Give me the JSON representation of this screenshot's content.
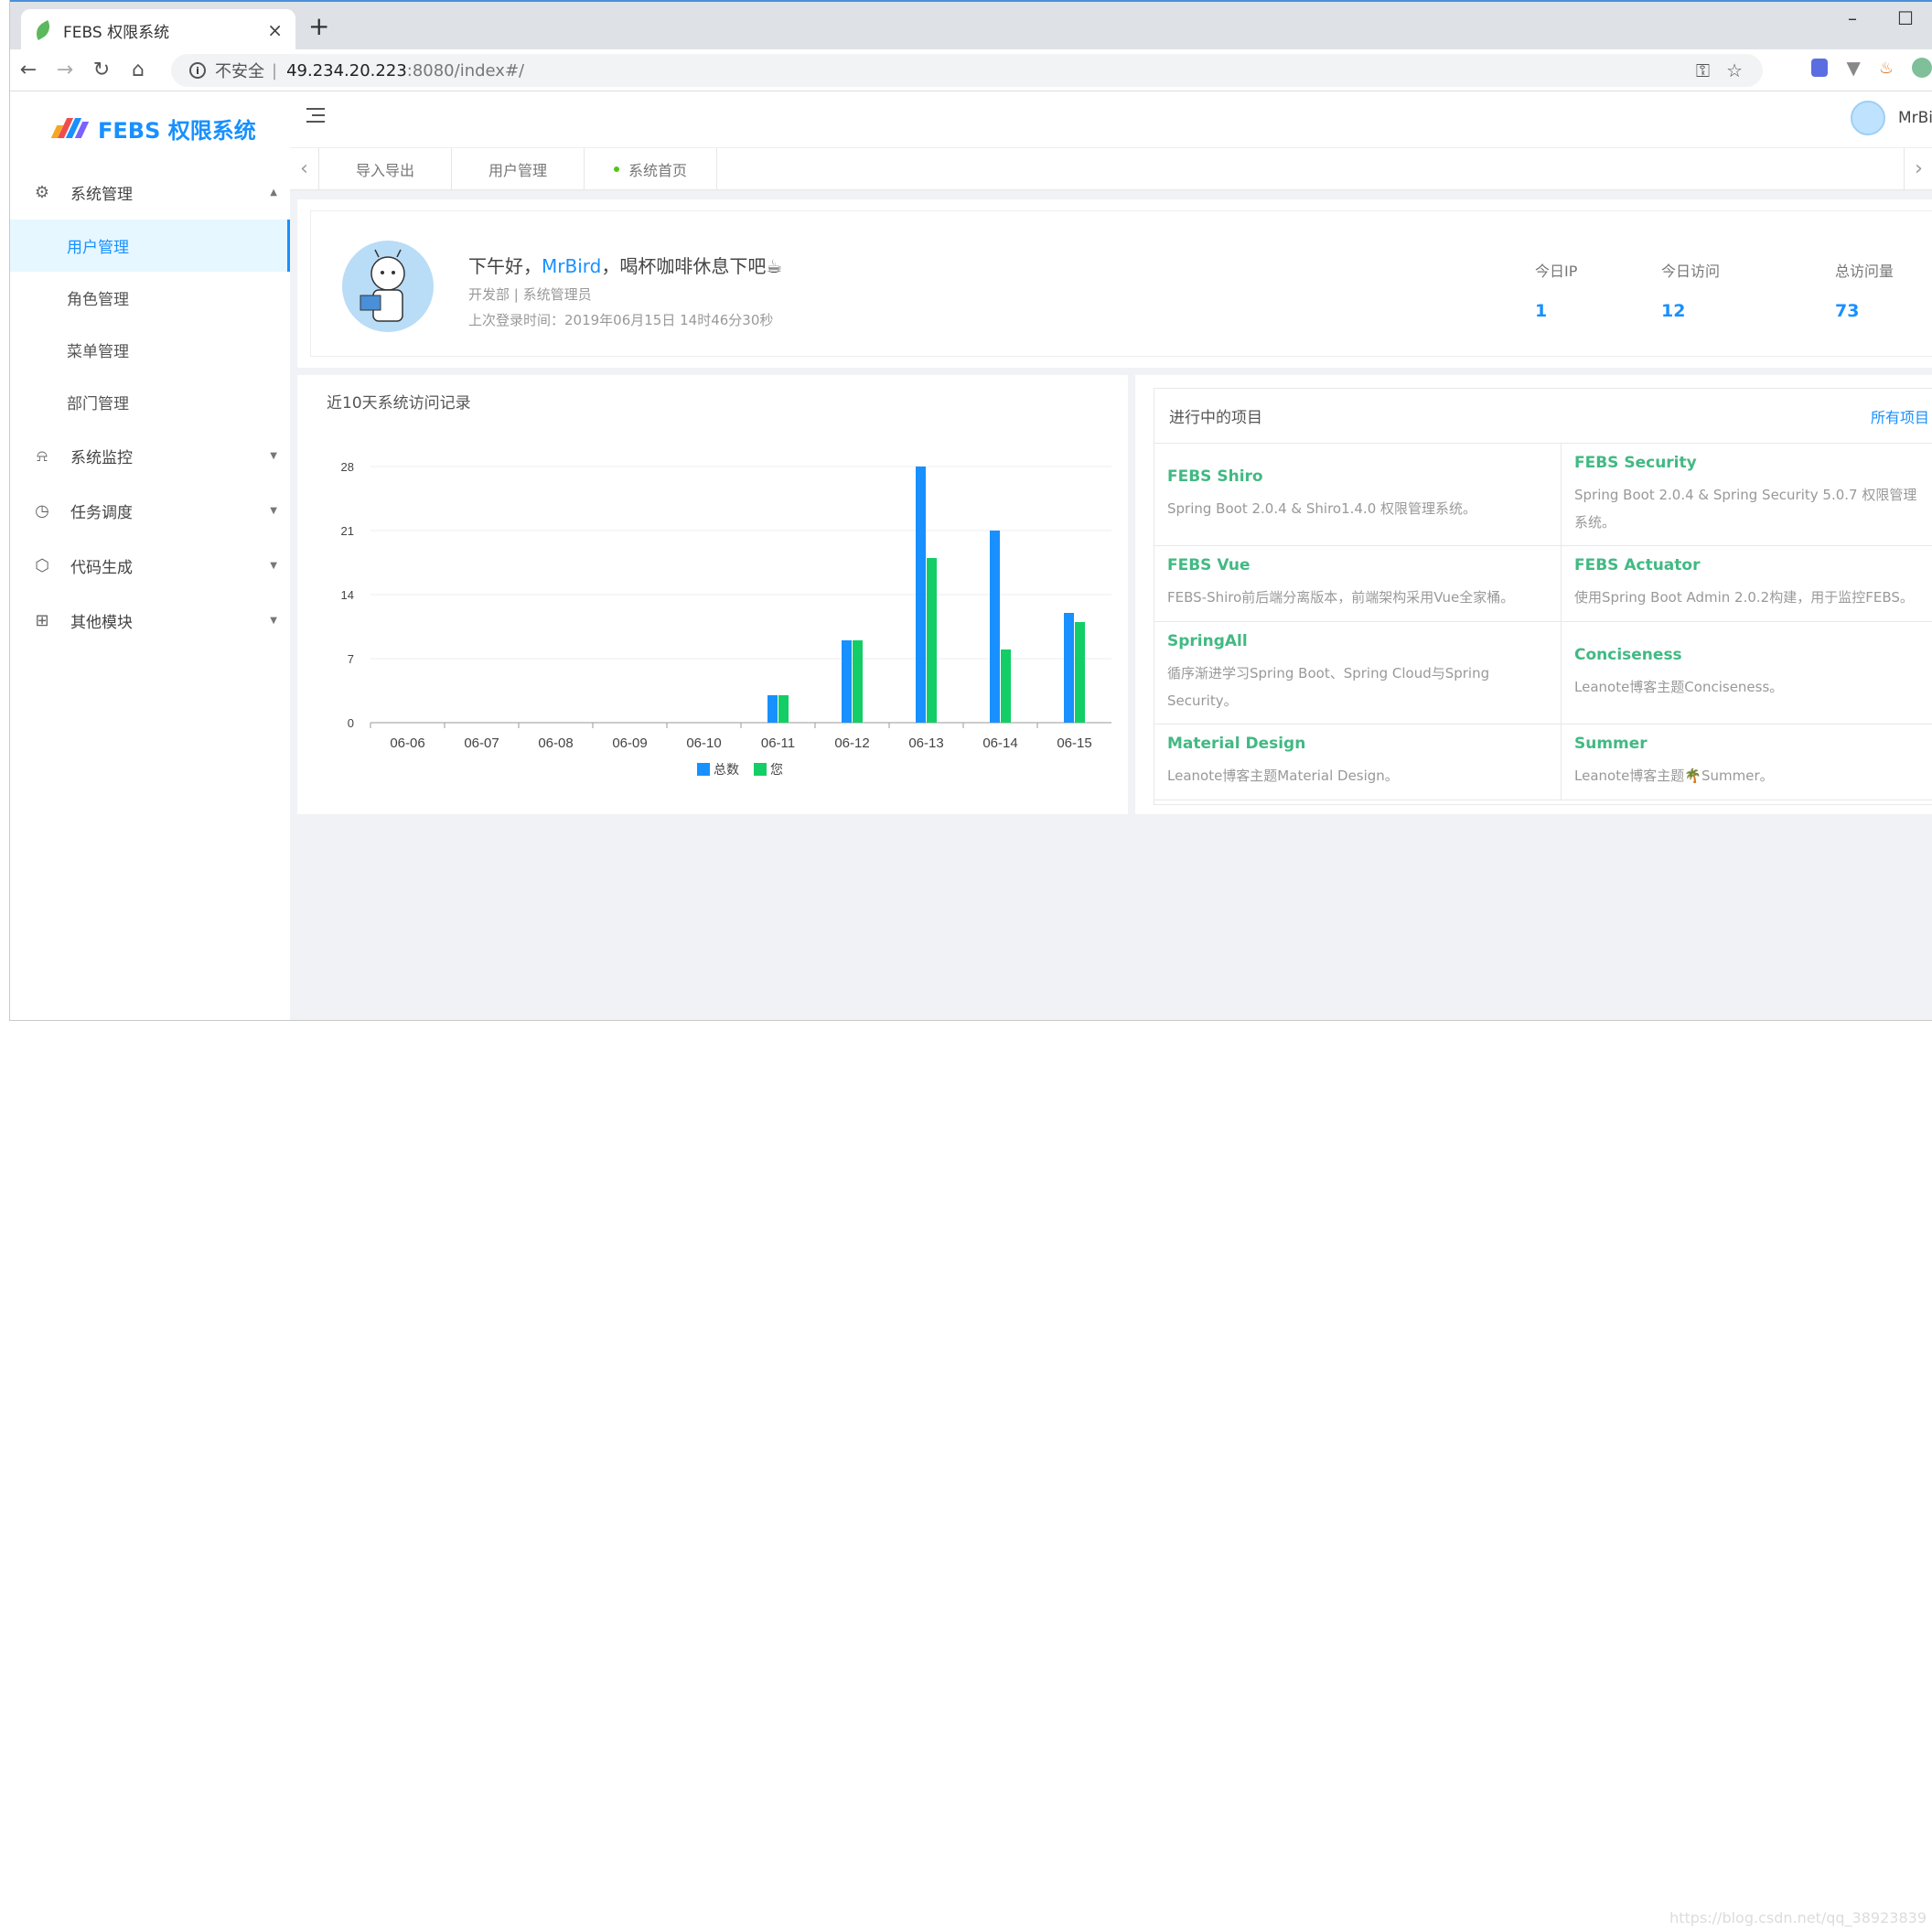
{
  "browser": {
    "tab_title": "FEBS 权限系统",
    "tab_close": "×",
    "new_tab": "+",
    "insecure_label": "不安全",
    "url_host": "49.234.20.223",
    "url_path": ":8080/index#/",
    "min": "–",
    "max": "☐"
  },
  "sidebar": {
    "logo_text": "FEBS 权限系统",
    "groups": [
      {
        "label": "系统管理",
        "icon": "gear-icon",
        "expanded": true
      },
      {
        "label": "系统监控",
        "icon": "alarm-icon"
      },
      {
        "label": "任务调度",
        "icon": "clock-icon"
      },
      {
        "label": "代码生成",
        "icon": "cube-icon"
      },
      {
        "label": "其他模块",
        "icon": "gift-icon"
      }
    ],
    "sub_items": [
      "用户管理",
      "角色管理",
      "菜单管理",
      "部门管理"
    ]
  },
  "header": {
    "username": "MrBi"
  },
  "page_tabs": [
    "导入导出",
    "用户管理",
    "系统首页"
  ],
  "welcome": {
    "greeting_prefix": "下午好，",
    "name": "MrBird",
    "greeting_suffix": "，喝杯咖啡休息下吧☕",
    "dept": "开发部 | 系统管理员",
    "last_login": "上次登录时间：2019年06月15日 14时46分30秒",
    "stats": [
      {
        "label": "今日IP",
        "value": "1"
      },
      {
        "label": "今日访问",
        "value": "12"
      },
      {
        "label": "总访问量",
        "value": "73"
      }
    ]
  },
  "chart_title": "近10天系统访问记录",
  "chart_data": {
    "type": "bar",
    "categories": [
      "06-06",
      "06-07",
      "06-08",
      "06-09",
      "06-10",
      "06-11",
      "06-12",
      "06-13",
      "06-14",
      "06-15"
    ],
    "series": [
      {
        "name": "总数",
        "values": [
          0,
          0,
          0,
          0,
          0,
          3,
          9,
          28,
          21,
          12
        ],
        "color": "#1890ff"
      },
      {
        "name": "您",
        "values": [
          0,
          0,
          0,
          0,
          0,
          3,
          9,
          18,
          8,
          11
        ],
        "color": "#13ce66"
      }
    ],
    "yticks": [
      0,
      7,
      14,
      21,
      28
    ],
    "ylim": [
      0,
      28
    ],
    "legend": "bottom-center",
    "grid": true
  },
  "projects": {
    "title": "进行中的项目",
    "all_label": "所有项目",
    "items": [
      {
        "name": "FEBS Shiro",
        "desc": "Spring Boot 2.0.4 & Shiro1.4.0 权限管理系统。"
      },
      {
        "name": "FEBS Security",
        "desc": "Spring Boot 2.0.4 & Spring Security 5.0.7 权限管理系统。"
      },
      {
        "name": "FEBS Vue",
        "desc": "FEBS-Shiro前后端分离版本，前端架构采用Vue全家桶。"
      },
      {
        "name": "FEBS Actuator",
        "desc": "使用Spring Boot Admin 2.0.2构建，用于监控FEBS。"
      },
      {
        "name": "SpringAll",
        "desc": "循序渐进学习Spring Boot、Spring Cloud与Spring Security。"
      },
      {
        "name": "Conciseness",
        "desc": "Leanote博客主题Conciseness。"
      },
      {
        "name": "Material Design",
        "desc": "Leanote博客主题Material Design。"
      },
      {
        "name": "Summer",
        "desc": "Leanote博客主题🌴Summer。"
      }
    ]
  },
  "watermark": "https://blog.csdn.net/qq_38923839"
}
